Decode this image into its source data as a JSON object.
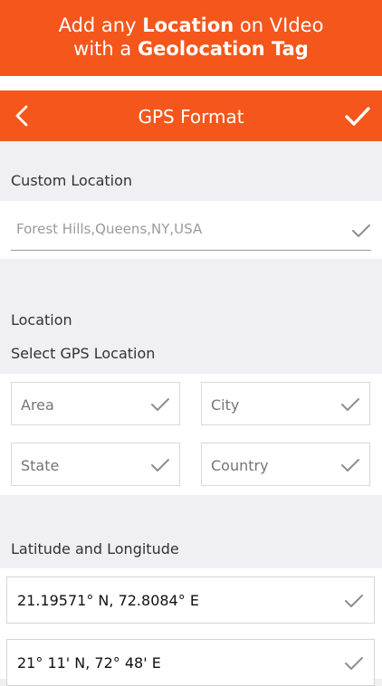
{
  "banner": {
    "line1_pre": "Add any ",
    "line1_bold": "Location",
    "line1_post": " on VIdeo",
    "line2_pre": "with a ",
    "line2_bold": "Geolocation Tag"
  },
  "navbar": {
    "title": "GPS Format",
    "back_icon": "chevron-left-icon",
    "done_icon": "checkmark-icon"
  },
  "custom_location": {
    "label": "Custom Location",
    "value": "Forest Hills,Queens,NY,USA"
  },
  "location": {
    "label": "Location",
    "sublabel": "Select GPS Location",
    "fields": [
      {
        "placeholder": "Area"
      },
      {
        "placeholder": "City"
      },
      {
        "placeholder": "State"
      },
      {
        "placeholder": "Country"
      }
    ]
  },
  "latlong": {
    "label": "Latitude and Longitude",
    "options": [
      {
        "text": "21.19571° N, 72.8084° E"
      },
      {
        "text": "21° 11' N, 72° 48' E"
      }
    ]
  },
  "colors": {
    "accent": "#f4561b",
    "background": "#efeff4",
    "check_gray": "#8e8e8e"
  }
}
